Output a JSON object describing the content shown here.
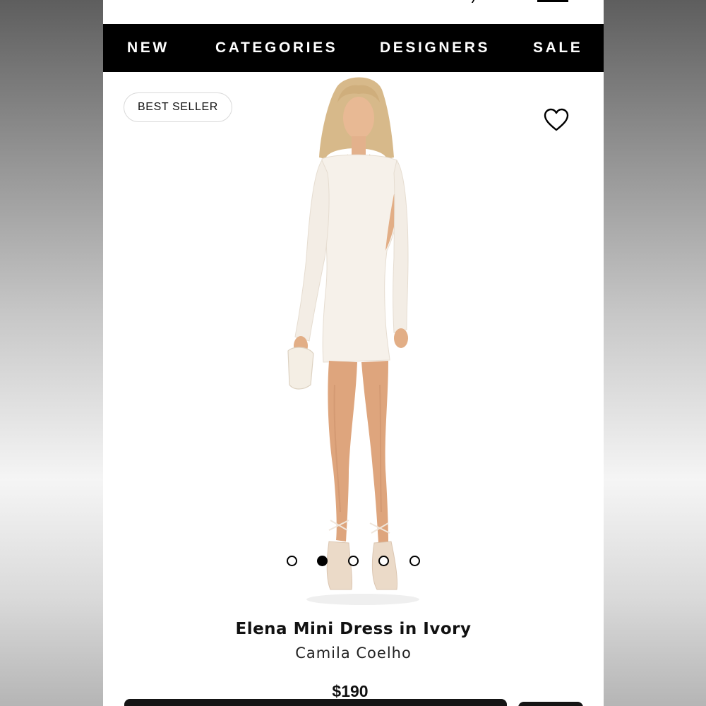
{
  "nav": {
    "items": [
      {
        "label": "NEW"
      },
      {
        "label": "CATEGORIES"
      },
      {
        "label": "DESIGNERS"
      },
      {
        "label": "SALE"
      }
    ]
  },
  "badge": {
    "label": "BEST SELLER"
  },
  "carousel": {
    "total_images": 5,
    "active_index": 2
  },
  "product": {
    "title": "Elena Mini Dress in Ivory",
    "brand": "Camila Coelho",
    "price": "$190"
  },
  "icons": {
    "wishlist": "heart-outline-icon"
  },
  "colors": {
    "nav_background": "#000000",
    "nav_text": "#ffffff",
    "page_background": "#ffffff",
    "active_dot": "#000000"
  }
}
